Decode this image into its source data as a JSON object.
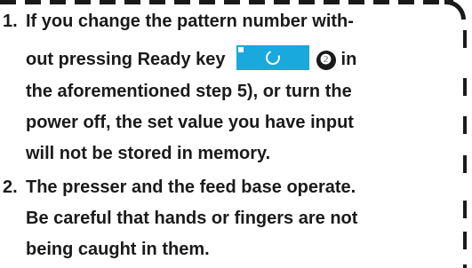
{
  "notes": {
    "item1": {
      "number": "1.",
      "line1": "If you change the pattern number with-",
      "line2_start": "out pressing Ready key",
      "step_marker": "❷",
      "line2_end": "in",
      "line3": "the aforementioned step 5), or turn the",
      "line4": "power off, the set value you have input",
      "line5": "will not be stored in memory."
    },
    "item2": {
      "number": "2.",
      "line1": "The presser and the feed base operate.",
      "line2": "Be careful that hands or fingers are not",
      "line3": "being caught in them."
    }
  },
  "icons": {
    "ready_key": "ready-key-icon"
  },
  "colors": {
    "text": "#1a1a1a",
    "ready_key": "#1aa9dc"
  }
}
